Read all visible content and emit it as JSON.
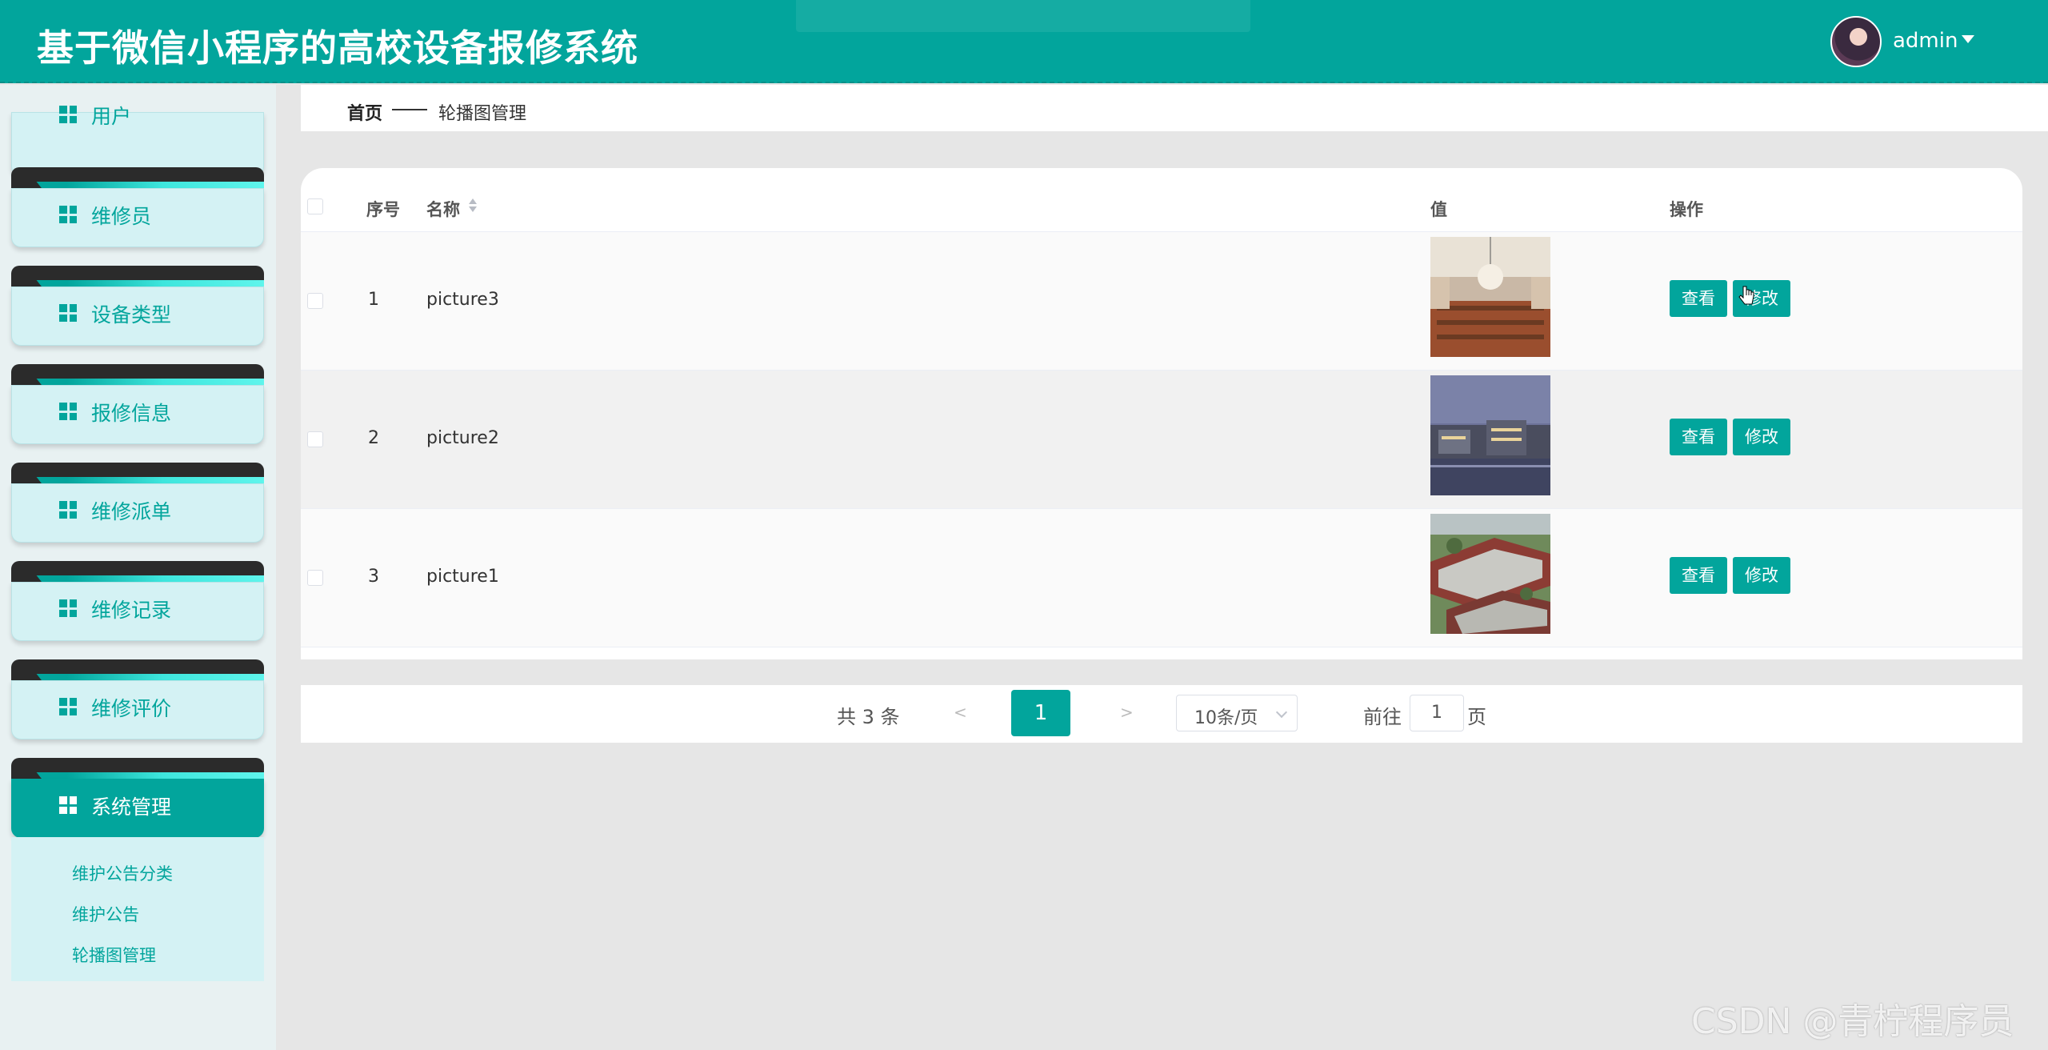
{
  "header": {
    "title": "基于微信小程序的高校设备报修系统",
    "user": "admin"
  },
  "sidebar": {
    "items": [
      {
        "label": "用户"
      },
      {
        "label": "维修员"
      },
      {
        "label": "设备类型"
      },
      {
        "label": "报修信息"
      },
      {
        "label": "维修派单"
      },
      {
        "label": "维修记录"
      },
      {
        "label": "维修评价"
      },
      {
        "label": "系统管理"
      }
    ],
    "submenu": [
      {
        "label": "维护公告分类"
      },
      {
        "label": "维护公告"
      },
      {
        "label": "轮播图管理"
      }
    ]
  },
  "breadcrumb": {
    "home": "首页",
    "current": "轮播图管理"
  },
  "table": {
    "columns": {
      "index": "序号",
      "name": "名称",
      "value": "值",
      "actions": "操作"
    },
    "rows": [
      {
        "index": "1",
        "name": "picture3"
      },
      {
        "index": "2",
        "name": "picture2"
      },
      {
        "index": "3",
        "name": "picture1"
      }
    ],
    "view_label": "查看",
    "edit_label": "修改"
  },
  "pagination": {
    "total": "共 3 条",
    "prev": "<",
    "next": ">",
    "current": "1",
    "page_size": "10条/页",
    "goto_label": "前往",
    "goto_value": "1",
    "page_suffix": "页"
  },
  "watermark": "CSDN @青柠程序员",
  "colors": {
    "primary": "#02a59c",
    "sidebar_bg": "#d4f2f4",
    "page_bg": "#e6e6e6"
  }
}
